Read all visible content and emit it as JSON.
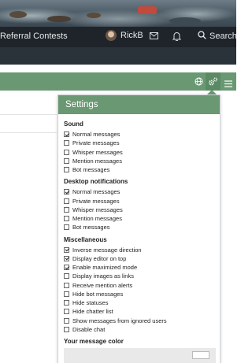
{
  "topnav": {
    "link": "Referral Contests",
    "username": "RickB",
    "search_label": "Search"
  },
  "settings": {
    "title": "Settings",
    "sections": [
      {
        "title": "Sound",
        "options": [
          {
            "label": "Normal messages",
            "checked": true
          },
          {
            "label": "Private messages",
            "checked": false
          },
          {
            "label": "Whisper messages",
            "checked": false
          },
          {
            "label": "Mention messages",
            "checked": false
          },
          {
            "label": "Bot messages",
            "checked": false
          }
        ]
      },
      {
        "title": "Desktop notifications",
        "options": [
          {
            "label": "Normal messages",
            "checked": true
          },
          {
            "label": "Private messages",
            "checked": false
          },
          {
            "label": "Whisper messages",
            "checked": false
          },
          {
            "label": "Mention messages",
            "checked": false
          },
          {
            "label": "Bot messages",
            "checked": false
          }
        ]
      },
      {
        "title": "Miscellaneous",
        "options": [
          {
            "label": "Inverse message direction",
            "checked": true
          },
          {
            "label": "Display editor on top",
            "checked": true
          },
          {
            "label": "Enable maximized mode",
            "checked": true
          },
          {
            "label": "Display images as links",
            "checked": false
          },
          {
            "label": "Receive mention alerts",
            "checked": false
          },
          {
            "label": "Hide bot messages",
            "checked": false
          },
          {
            "label": "Hide statuses",
            "checked": false
          },
          {
            "label": "Hide chatter list",
            "checked": false
          },
          {
            "label": "Show messages from ignored users",
            "checked": false
          },
          {
            "label": "Disable chat",
            "checked": false
          }
        ]
      }
    ],
    "color_title": "Your message color"
  },
  "colors": {
    "accent_green": "#6a9873",
    "nav_dark": "#1e242a"
  }
}
